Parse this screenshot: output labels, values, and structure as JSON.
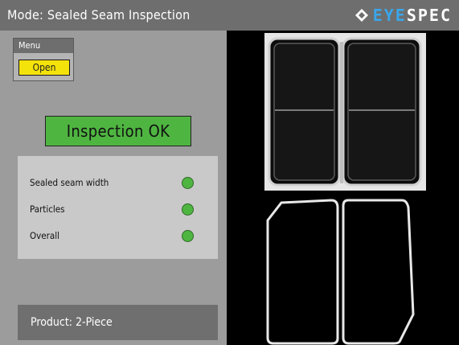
{
  "header": {
    "mode_label": "Mode:  Sealed Seam Inspection",
    "logo_part1": "EYE",
    "logo_part2": "SPEC",
    "logo_icon": "diamond-logo-icon"
  },
  "menu": {
    "title": "Menu",
    "open_label": "Open"
  },
  "status": {
    "text": "Inspection  OK",
    "color": "#4fb541"
  },
  "results": [
    {
      "label": "Sealed seam width",
      "status": "ok",
      "color": "#4fb541"
    },
    {
      "label": "Particles",
      "status": "ok",
      "color": "#4fb541"
    },
    {
      "label": "Overall",
      "status": "ok",
      "color": "#4fb541"
    }
  ],
  "product": {
    "text": "Product: 2-Piece"
  },
  "colors": {
    "header_bg": "#6e6e6e",
    "panel_bg": "#9c9c9c",
    "button_yellow": "#f4e20b",
    "ok_green": "#4fb541",
    "logo_blue": "#3aa6ea"
  }
}
